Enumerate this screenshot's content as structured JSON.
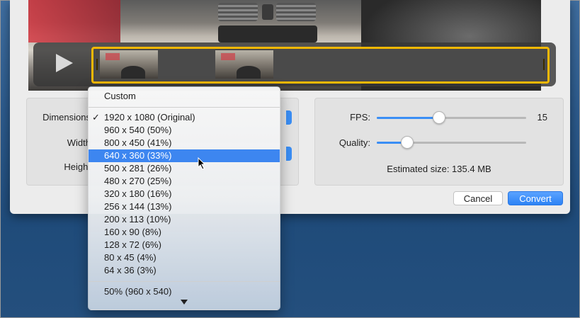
{
  "preview": {
    "play_label": "Play"
  },
  "left_panel": {
    "dimensions_label": "Dimensions",
    "width_label": "Width",
    "height_label": "Height"
  },
  "right_panel": {
    "fps_label": "FPS:",
    "fps_value": "15",
    "fps_fraction": 0.41,
    "quality_label": "Quality:",
    "quality_fraction": 0.2,
    "estimated_size": "Estimated size: 135.4 MB"
  },
  "buttons": {
    "cancel": "Cancel",
    "convert": "Convert"
  },
  "menu": {
    "custom": "Custom",
    "checkmark": "✓",
    "options": [
      "1920 x 1080 (Original)",
      "960 x 540 (50%)",
      "800 x 450 (41%)",
      "640 x 360 (33%)",
      "500 x 281 (26%)",
      "480 x 270 (25%)",
      "320 x 180 (16%)",
      "256 x 144 (13%)",
      "200 x 113 (10%)",
      "160 x 90 (8%)",
      "128 x 72 (6%)",
      "80 x 45 (4%)",
      "64 x 36 (3%)"
    ],
    "checked_index": 0,
    "highlighted_index": 3,
    "current_selection": "50% (960 x 540)"
  },
  "colors": {
    "accent": "#3d86f0",
    "trim_handle": "#f5b800"
  }
}
